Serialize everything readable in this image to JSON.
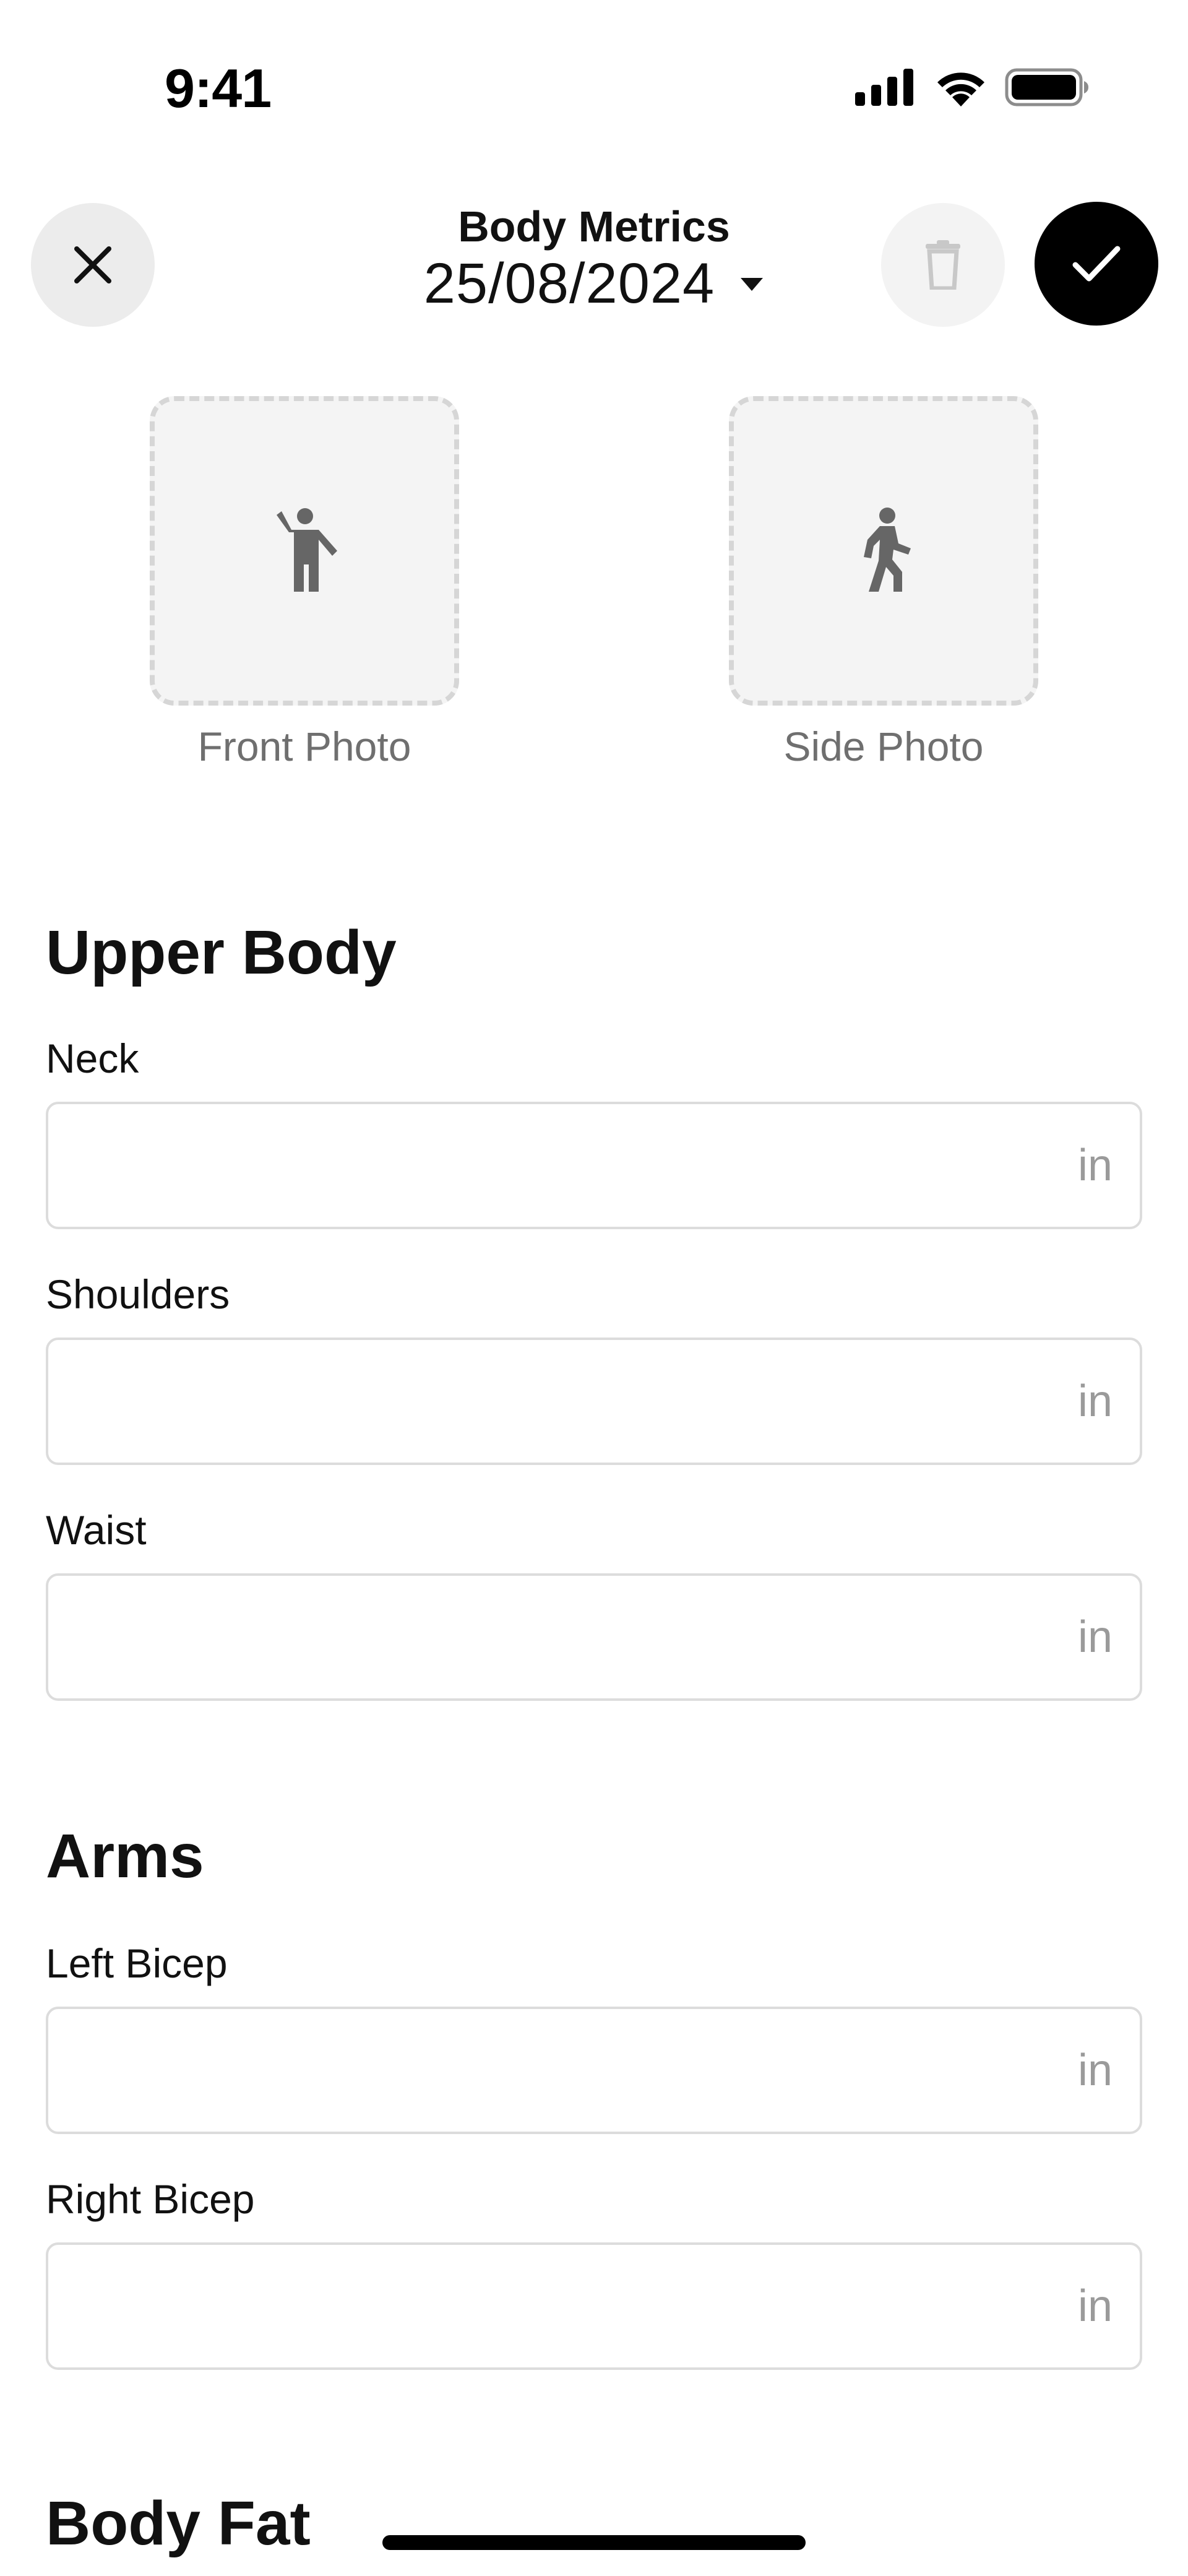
{
  "status_bar": {
    "time": "9:41",
    "icons": [
      "cellular-signal-icon",
      "wifi-icon",
      "battery-icon"
    ]
  },
  "header": {
    "title": "Body Metrics",
    "date": "25/08/2024",
    "close_icon": "close-icon",
    "dropdown_icon": "caret-down-icon",
    "delete_icon": "trash-icon",
    "confirm_icon": "checkmark-icon"
  },
  "photos": {
    "front_label": "Front Photo",
    "side_label": "Side Photo",
    "front_icon": "person-standing-icon",
    "side_icon": "person-walking-icon"
  },
  "sections": {
    "upper_body": {
      "title": "Upper Body",
      "fields": [
        {
          "label": "Neck",
          "value": "",
          "unit": "in"
        },
        {
          "label": "Shoulders",
          "value": "",
          "unit": "in"
        },
        {
          "label": "Waist",
          "value": "",
          "unit": "in"
        }
      ]
    },
    "arms": {
      "title": "Arms",
      "fields": [
        {
          "label": "Left Bicep",
          "value": "",
          "unit": "in"
        },
        {
          "label": "Right Bicep",
          "value": "",
          "unit": "in"
        }
      ]
    },
    "body_fat": {
      "title": "Body Fat"
    }
  },
  "colors": {
    "accent": "#000000",
    "input_border": "#dcdcdc",
    "photo_background": "#f4f4f4",
    "muted_text": "#6f6f6f",
    "unit_text": "#9a9a9a"
  }
}
